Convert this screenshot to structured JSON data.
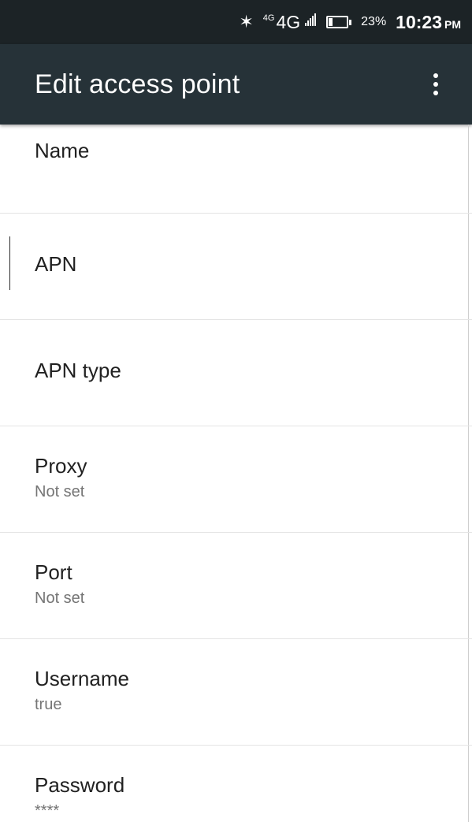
{
  "status_bar": {
    "network_small": "4G",
    "network": "4G",
    "battery_percent": "23%",
    "time": "10:23",
    "ampm": "PM",
    "bluetooth_icon": "bluetooth-icon",
    "signal_icon": "signal-icon",
    "battery_icon": "battery-charging-icon"
  },
  "app_bar": {
    "title": "Edit access point",
    "overflow_icon": "more-vert-icon"
  },
  "items": [
    {
      "title": "Name",
      "summary": ""
    },
    {
      "title": "APN",
      "summary": ""
    },
    {
      "title": "APN type",
      "summary": ""
    },
    {
      "title": "Proxy",
      "summary": "Not set"
    },
    {
      "title": "Port",
      "summary": "Not set"
    },
    {
      "title": "Username",
      "summary": "true"
    },
    {
      "title": "Password",
      "summary": "****"
    }
  ],
  "colors": {
    "status_bar_bg": "#1c2326",
    "app_bar_bg": "#263238",
    "title_text": "#212121",
    "summary_text": "#757575"
  }
}
